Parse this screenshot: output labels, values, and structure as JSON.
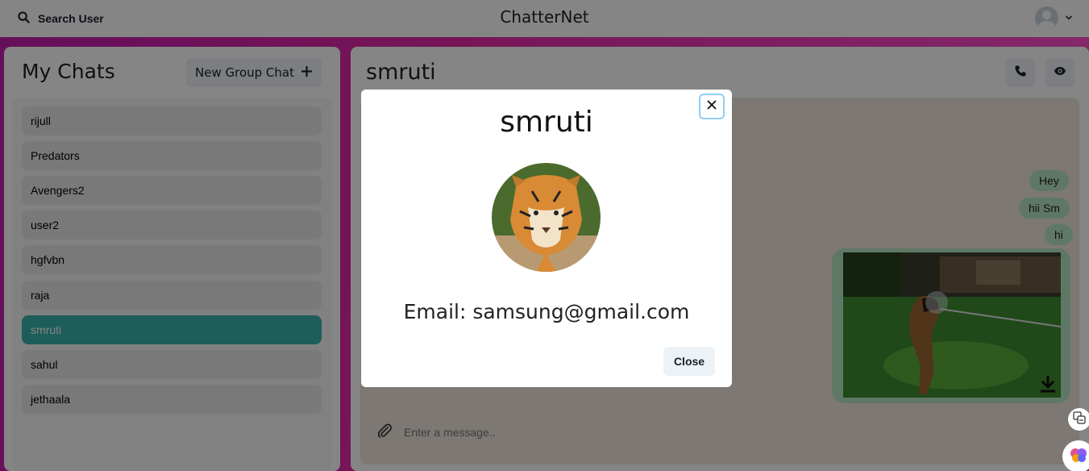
{
  "topbar": {
    "search_label": "Search User",
    "brand": "ChatterNet"
  },
  "chats": {
    "title": "My Chats",
    "new_group_label": "New Group Chat",
    "items": [
      {
        "label": "rijull",
        "active": false
      },
      {
        "label": "Predators",
        "active": false
      },
      {
        "label": "Avengers2",
        "active": false
      },
      {
        "label": "user2",
        "active": false
      },
      {
        "label": "hgfvbn",
        "active": false
      },
      {
        "label": "raja",
        "active": false
      },
      {
        "label": "smruti",
        "active": true
      },
      {
        "label": "sahul",
        "active": false
      },
      {
        "label": "jethaala",
        "active": false
      }
    ]
  },
  "conversation": {
    "title": "smruti",
    "messages": [
      {
        "text": "Hey"
      },
      {
        "text": "hii Sm"
      },
      {
        "text": "hi"
      }
    ],
    "input_placeholder": "Enter a message.."
  },
  "modal": {
    "title": "smruti",
    "email": "Email: samsung@gmail.com",
    "close_label": "Close"
  },
  "colors": {
    "accent": "#38b2ac",
    "bubble": "#b7e7c3",
    "wallpaper": "#e52aa8",
    "focus_ring": "#90cdf4"
  }
}
